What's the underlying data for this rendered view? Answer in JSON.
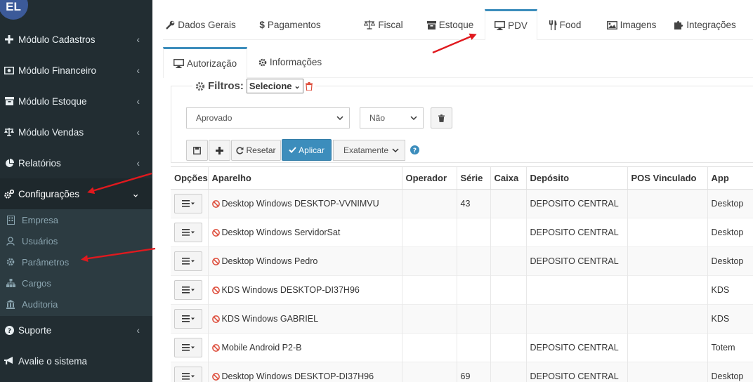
{
  "sidebar": {
    "avatar_initials": "EL",
    "items": [
      {
        "label": "Módulo Cadastros",
        "icon": "plus-icon"
      },
      {
        "label": "Módulo Financeiro",
        "icon": "money-icon"
      },
      {
        "label": "Módulo Estoque",
        "icon": "archive-icon"
      },
      {
        "label": "Módulo Vendas",
        "icon": "balance-scale-icon"
      },
      {
        "label": "Relatórios",
        "icon": "pie-chart-icon"
      },
      {
        "label": "Configurações",
        "icon": "cogs-icon"
      }
    ],
    "submenu": [
      {
        "label": "Empresa",
        "icon": "building-icon"
      },
      {
        "label": "Usuários",
        "icon": "user-icon"
      },
      {
        "label": "Parâmetros",
        "icon": "gear-icon"
      },
      {
        "label": "Cargos",
        "icon": "sitemap-icon"
      },
      {
        "label": "Auditoria",
        "icon": "bank-icon"
      }
    ],
    "support": {
      "label": "Suporte",
      "icon": "question-circle-icon"
    },
    "rate": {
      "label": "Avalie o sistema",
      "icon": "bullhorn-icon"
    }
  },
  "tabs": [
    {
      "label": "Dados Gerais",
      "icon": "wrench-icon"
    },
    {
      "label": "Pagamentos",
      "icon": "dollar-icon"
    },
    {
      "label": "Fiscal",
      "icon": "balance-scale-icon"
    },
    {
      "label": "Estoque",
      "icon": "archive-icon"
    },
    {
      "label": "PDV",
      "icon": "desktop-icon"
    },
    {
      "label": "Food",
      "icon": "cutlery-icon"
    },
    {
      "label": "Imagens",
      "icon": "image-icon"
    },
    {
      "label": "Integrações",
      "icon": "puzzle-icon"
    }
  ],
  "subtabs": [
    {
      "label": "Autorização",
      "icon": "desktop-icon"
    },
    {
      "label": "Informações",
      "icon": "gear-icon"
    }
  ],
  "filters": {
    "title": "Filtros:",
    "preset": "Selecione",
    "status": "Aprovado",
    "flag": "Não",
    "reset_label": "Resetar",
    "apply_label": "Aplicar",
    "match": "Exatamente"
  },
  "table": {
    "columns": [
      "Opções",
      "Aparelho",
      "Operador",
      "Série",
      "Caixa",
      "Depósito",
      "POS Vinculado",
      "App"
    ],
    "rows": [
      {
        "device": "Desktop Windows DESKTOP-VVNIMVU",
        "operator": "",
        "serie": "43",
        "caixa": "",
        "deposito": "DEPOSITO CENTRAL",
        "pos": "",
        "app": "Desktop"
      },
      {
        "device": "Desktop Windows ServidorSat",
        "operator": "",
        "serie": "",
        "caixa": "",
        "deposito": "DEPOSITO CENTRAL",
        "pos": "",
        "app": "Desktop"
      },
      {
        "device": "Desktop Windows Pedro",
        "operator": "",
        "serie": "",
        "caixa": "",
        "deposito": "DEPOSITO CENTRAL",
        "pos": "",
        "app": "Desktop"
      },
      {
        "device": "KDS Windows DESKTOP-DI37H96",
        "operator": "",
        "serie": "",
        "caixa": "",
        "deposito": "",
        "pos": "",
        "app": "KDS"
      },
      {
        "device": "KDS Windows GABRIEL",
        "operator": "",
        "serie": "",
        "caixa": "",
        "deposito": "",
        "pos": "",
        "app": "KDS"
      },
      {
        "device": "Mobile Android P2-B",
        "operator": "",
        "serie": "",
        "caixa": "",
        "deposito": "DEPOSITO CENTRAL",
        "pos": "",
        "app": "Totem"
      },
      {
        "device": "Desktop Windows DESKTOP-DI37H96",
        "operator": "",
        "serie": "69",
        "caixa": "",
        "deposito": "DEPOSITO CENTRAL",
        "pos": "",
        "app": "Desktop"
      }
    ]
  },
  "colors": {
    "sidebar": "#222d32",
    "accent": "#3c8dbc",
    "arrow": "#e0191e",
    "ban": "#dd4b39"
  }
}
